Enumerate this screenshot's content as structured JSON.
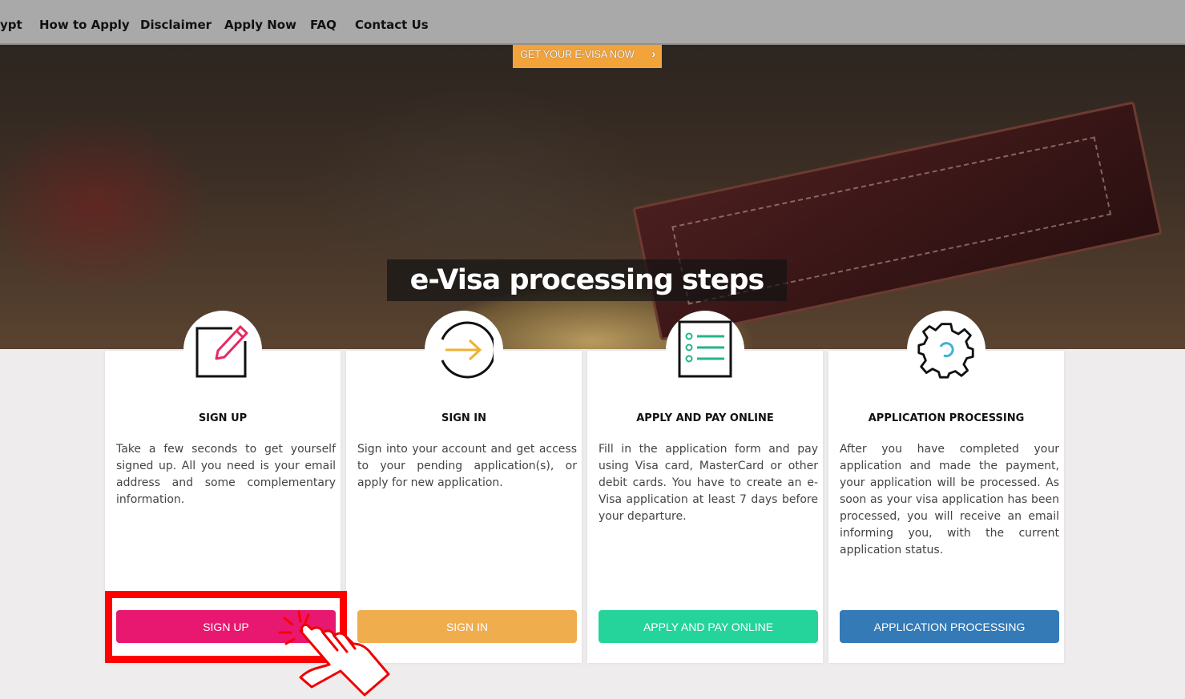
{
  "nav": {
    "items": [
      "ypt",
      "How to Apply",
      "Disclaimer",
      "Apply Now",
      "FAQ",
      "Contact Us"
    ]
  },
  "hero": {
    "cta_label": "GET YOUR E-VISA NOW",
    "heading": "e-Visa processing steps"
  },
  "steps": [
    {
      "icon": "edit-icon",
      "title": "SIGN UP",
      "description": "Take a few seconds to get yourself signed up. All you need is your email address and some complementary information.",
      "button": "SIGN UP",
      "color": "#e8176f"
    },
    {
      "icon": "arrow-right-circle-icon",
      "title": "SIGN IN",
      "description": "Sign into your account and get access to your pending application(s), or apply for new application.",
      "button": "SIGN IN",
      "color": "#f0ad4e"
    },
    {
      "icon": "checklist-icon",
      "title": "APPLY AND PAY ONLINE",
      "description": "Fill in the application form and pay using Visa card, MasterCard or other debit cards. You have to create an e-Visa application at least 7 days before your departure.",
      "button": "APPLY AND PAY ONLINE",
      "color": "#25d49a"
    },
    {
      "icon": "gear-icon",
      "title": "APPLICATION PROCESSING",
      "description": "After you have completed your application and made the payment, your application will be processed. As soon as your visa application has been processed, you will receive an email informing you, with the current application status.",
      "button": "APPLICATION PROCESSING",
      "color": "#337ab7"
    }
  ],
  "colors": {
    "nav_bg": "#a9a9a9",
    "cta_bg": "#f2a33a",
    "highlight": "#ff0000",
    "page_bg": "#eeeced"
  }
}
